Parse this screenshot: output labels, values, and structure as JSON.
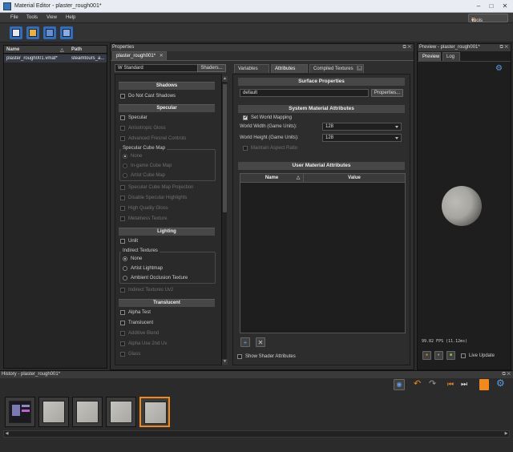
{
  "window": {
    "title": "Material Editor - plaster_rough001*",
    "minimize": "–",
    "maximize": "□",
    "close": "✕"
  },
  "menu": {
    "file": "File",
    "tools": "Tools",
    "view": "View",
    "help": "Help",
    "tools_button": "Tools",
    "tools_arrow": "▾"
  },
  "file_browser": {
    "col_name": "Name",
    "col_sort": "△",
    "col_path": "Path",
    "row": {
      "name": "plaster_rough001.vmat*",
      "path": "steamtours_a..."
    }
  },
  "properties": {
    "title": "Properties",
    "float": "⧉",
    "close": "✕",
    "tab": "plaster_rough001*",
    "tab_close": "✕",
    "shader_value": "W Standard",
    "shaders_button": "Shaders...",
    "sections": {
      "shadows": "Shadows",
      "specular": "Specular",
      "lighting": "Lighting",
      "translucent": "Translucent"
    },
    "shadows_items": [
      "Do Not Cast Shadows"
    ],
    "specular_items": [
      "Specular",
      "Anisotropic Gloss",
      "Advanced Fresnel Controls"
    ],
    "specular_cube_map": {
      "title": "Specular Cube Map",
      "options": [
        "None",
        "In-game Cube Map",
        "Artist Cube Map"
      ]
    },
    "specular_items2": [
      "Specular Cube Map Projection",
      "Disable Specular Highlights",
      "High Quality Gloss",
      "Metalness Texture"
    ],
    "lighting_items": [
      "Unlit"
    ],
    "indirect_textures": {
      "title": "Indirect Textures",
      "options": [
        "None",
        "Artist Lightmap",
        "Ambient Occlusion Texture"
      ]
    },
    "indirect_uv2": "Indirect Textures Uv2",
    "translucent_items": [
      "Alpha Test",
      "Translucent",
      "Additive Blend",
      "Alpha Use 2nd Uv",
      "Glass"
    ],
    "right_tabs": [
      "Variables",
      "Attributes",
      "Compiled Textures"
    ],
    "right_tab_close": "✕",
    "surface_properties": {
      "header": "Surface Properties",
      "value": "default",
      "button": "Properties..."
    },
    "system_attributes": {
      "header": "System Material Attributes",
      "set_world_mapping": "Set World Mapping",
      "check": "✔",
      "world_width_label": "World Width (Game Units):",
      "world_width": "128",
      "world_height_label": "World Height (Game Units):",
      "world_height": "128",
      "maintain_aspect": "Maintain Aspect Ratio"
    },
    "user_attributes": {
      "header": "User Material Attributes",
      "col_name": "Name",
      "col_sort": "△",
      "col_value": "Value",
      "add": "+",
      "remove": "✕"
    },
    "show_shader_attributes": "Show Shader Attributes"
  },
  "preview": {
    "title": "Preview - plaster_rough001*",
    "tabs": [
      "Preview",
      "Log"
    ],
    "fps": "99.82 FPS (11.12ms)",
    "live_update": "Live Update",
    "settings_icon": "⚙"
  },
  "history": {
    "title": "History - plaster_rough001*"
  },
  "colors": {
    "accent": "#f08a1a",
    "panel": "#2e2e2e",
    "header": "#474747"
  }
}
